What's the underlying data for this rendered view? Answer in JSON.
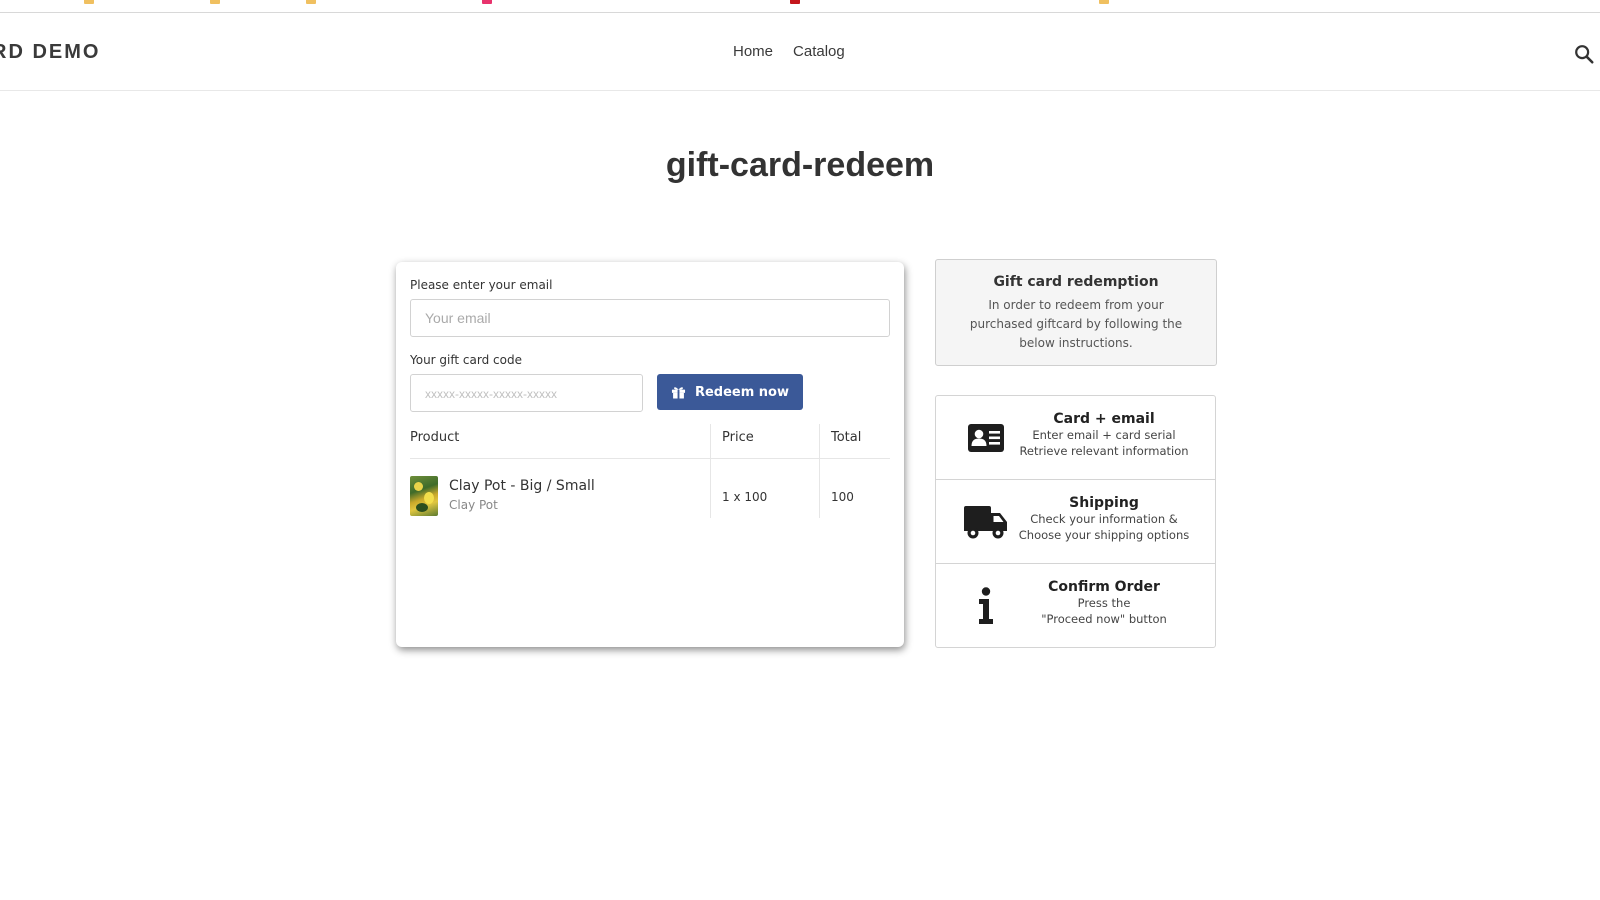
{
  "header": {
    "logo_text": "RD DEMO",
    "nav": [
      {
        "label": "Home"
      },
      {
        "label": "Catalog"
      }
    ],
    "search_icon": "search-icon"
  },
  "page": {
    "title": "gift-card-redeem"
  },
  "form": {
    "email_label": "Please enter your email",
    "email_placeholder": "Your email",
    "email_value": "",
    "code_label": "Your gift card code",
    "code_placeholder": "xxxxx-xxxxx-xxxxx-xxxxx",
    "code_value": "",
    "redeem_button": "Redeem now",
    "redeem_icon": "gift-icon",
    "button_color": "#3b5998"
  },
  "table": {
    "headers": [
      "Product",
      "Price",
      "Total"
    ],
    "rows": [
      {
        "name": "Clay Pot - Big / Small",
        "variant": "Clay Pot",
        "price": "1 x 100",
        "total": "100"
      }
    ]
  },
  "info": {
    "title": "Gift card redemption",
    "text": "In order to redeem from your purchased giftcard by following the below instructions."
  },
  "steps": [
    {
      "icon": "id-card-icon",
      "title": "Card + email",
      "lines": [
        "Enter email + card serial",
        "Retrieve relevant information"
      ]
    },
    {
      "icon": "truck-icon",
      "title": "Shipping",
      "lines": [
        "Check your information &",
        "Choose your shipping options"
      ]
    },
    {
      "icon": "info-icon",
      "title": "Confirm Order",
      "lines": [
        "Press the",
        "\"Proceed now\" button"
      ]
    }
  ]
}
